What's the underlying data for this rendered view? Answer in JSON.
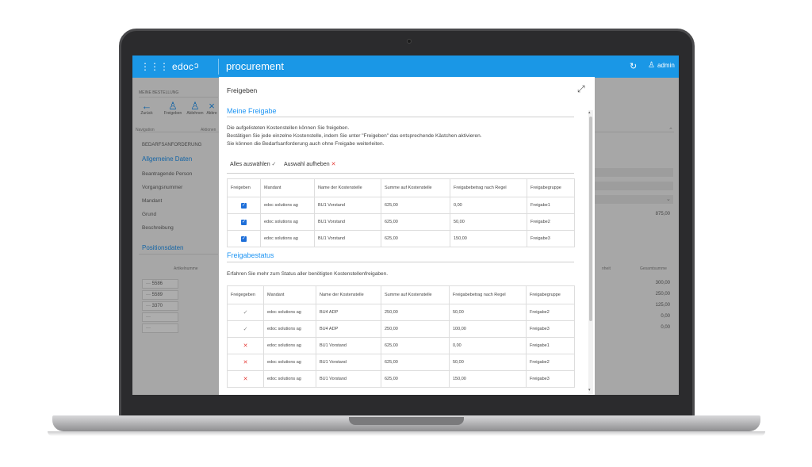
{
  "topbar": {
    "brand": "edoc",
    "app_name": "procurement",
    "user_name": "admin",
    "grid_icon": "grid-icon",
    "refresh_icon": "refresh-icon",
    "user_icon": "user-icon"
  },
  "background": {
    "page_title": "MEINE BESTELLUNG",
    "toolbar": [
      "Zurück",
      "Freigeben",
      "Ablehnen",
      "Abbre"
    ],
    "toolbar_group_left": "Navigation",
    "toolbar_group_right": "Aktionen",
    "section_label": "BEDARFSANFORDERUNG",
    "general_heading": "Allgemeine Daten",
    "fields": [
      "Beantragende Person",
      "Vorgangsnummer",
      "Mandant",
      "Grund",
      "Beschreibung"
    ],
    "amount": "875,00",
    "positions_heading": "Positionsdaten",
    "col_article": "Artikelnumme",
    "col_unit": "nheit",
    "col_total": "Gesamtsumme",
    "rows": [
      "5586",
      "5589",
      "3370",
      "",
      ""
    ],
    "totals": [
      "300,00",
      "250,00",
      "125,00",
      "0,00",
      "0,00"
    ]
  },
  "modal": {
    "title": "Freigeben",
    "my_section": "Meine Freigabe",
    "intro_lines": [
      "Die aufgelisteten Kostenstellen können Sie freigeben.",
      "Bestätigen Sie jede einzelne Kostenstelle, indem Sie unter \"Freigeben\" das entsprechende Kästchen aktivieren.",
      "Sie können die Bedarfsanforderung auch ohne Freigabe weiterleiten."
    ],
    "select_all": "Alles auswählen",
    "deselect_all": "Auswahl aufheben",
    "table1": {
      "headers": [
        "Freigeben",
        "Mandant",
        "Name der Kostenstelle",
        "Summe auf Kostenstelle",
        "Freigabebetrag nach Regel",
        "Freigabegruppe"
      ],
      "rows": [
        {
          "checked": true,
          "mandant": "edoc solutions ag",
          "name": "BU1 Vorstand",
          "summe": "625,00",
          "betrag": "0,00",
          "gruppe": "Freigabe1"
        },
        {
          "checked": true,
          "mandant": "edoc solutions ag",
          "name": "BU1 Vorstand",
          "summe": "625,00",
          "betrag": "50,00",
          "gruppe": "Freigabe2"
        },
        {
          "checked": true,
          "mandant": "edoc solutions ag",
          "name": "BU1 Vorstand",
          "summe": "625,00",
          "betrag": "150,00",
          "gruppe": "Freigabe3"
        }
      ]
    },
    "status_section": "Freigabestatus",
    "status_intro": "Erfahren Sie mehr zum Status aller benötigten Kostenstellenfreigaben.",
    "table2": {
      "headers": [
        "Freigegeben",
        "Mandant",
        "Name der Kostenstelle",
        "Summe auf Kostenstelle",
        "Freigabebetrag nach Regel",
        "Freigabegruppe"
      ],
      "rows": [
        {
          "status": "approved",
          "mandant": "edoc solutions ag",
          "name": "BU4 ADP",
          "summe": "250,00",
          "betrag": "50,00",
          "gruppe": "Freigabe2"
        },
        {
          "status": "approved",
          "mandant": "edoc solutions ag",
          "name": "BU4 ADP",
          "summe": "250,00",
          "betrag": "100,00",
          "gruppe": "Freigabe3"
        },
        {
          "status": "rejected",
          "mandant": "edoc solutions ag",
          "name": "BU1 Vorstand",
          "summe": "625,00",
          "betrag": "0,00",
          "gruppe": "Freigabe1"
        },
        {
          "status": "rejected",
          "mandant": "edoc solutions ag",
          "name": "BU1 Vorstand",
          "summe": "625,00",
          "betrag": "50,00",
          "gruppe": "Freigabe2"
        },
        {
          "status": "rejected",
          "mandant": "edoc solutions ag",
          "name": "BU1 Vorstand",
          "summe": "625,00",
          "betrag": "150,00",
          "gruppe": "Freigabe3"
        }
      ]
    }
  },
  "colors": {
    "accent": "#1a97e6",
    "check": "#1e6fd9",
    "reject": "#e53935"
  }
}
